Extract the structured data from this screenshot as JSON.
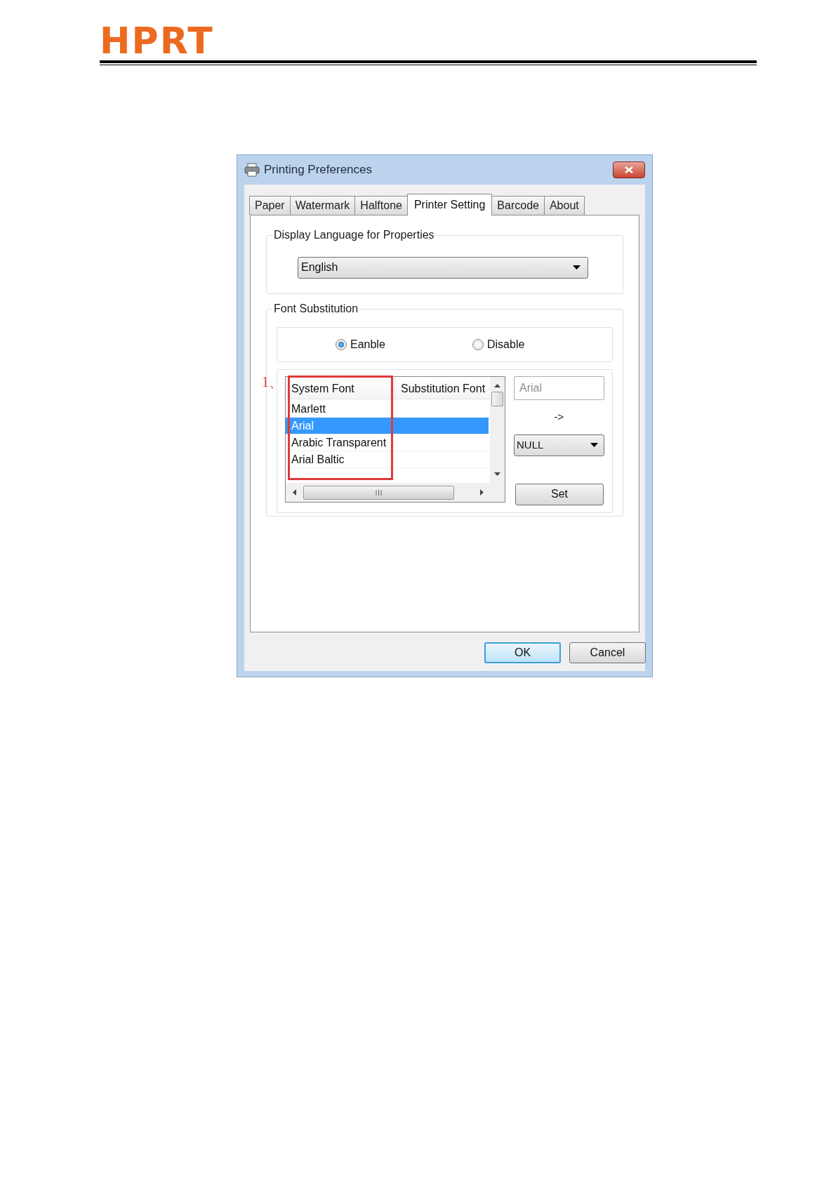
{
  "header": {
    "logo": "HPRT"
  },
  "dialog": {
    "title": "Printing Preferences",
    "tabs": [
      {
        "label": "Paper",
        "selected": false
      },
      {
        "label": "Watermark",
        "selected": false
      },
      {
        "label": "Halftone",
        "selected": false
      },
      {
        "label": "Printer Setting",
        "selected": true
      },
      {
        "label": "Barcode",
        "selected": false
      },
      {
        "label": "About",
        "selected": false
      }
    ],
    "language_group": {
      "label": "Display Language for Properties",
      "value": "English"
    },
    "font_group": {
      "label": "Font Substitution",
      "options": [
        {
          "label": "Eanble",
          "selected": true
        },
        {
          "label": "Disable",
          "selected": false
        }
      ],
      "table": {
        "columns": [
          "System Font",
          "Substitution Font"
        ],
        "rows": [
          {
            "system_font": "Marlett",
            "selected": false
          },
          {
            "system_font": "Arial",
            "selected": true
          },
          {
            "system_font": "Arabic Transparent",
            "selected": false
          },
          {
            "system_font": "Arial Baltic",
            "selected": false
          }
        ]
      },
      "source_field": {
        "placeholder": "Arial"
      },
      "arrow": "->",
      "target": {
        "value": "NULL"
      },
      "set_button": "Set"
    },
    "buttons": [
      {
        "label": "OK",
        "default": true
      },
      {
        "label": "Cancel",
        "default": false
      }
    ]
  },
  "annotation": {
    "label": "1、"
  }
}
